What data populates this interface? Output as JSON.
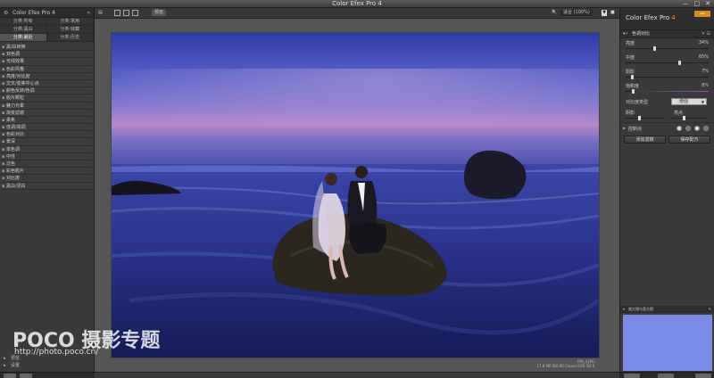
{
  "window": {
    "title": "Color Efex Pro 4",
    "buttons": [
      "—",
      "□",
      "✕"
    ]
  },
  "left_panel": {
    "brand": "Color Efex Pro 4",
    "categories": [
      "分类:所有",
      "分类:常用",
      "分类:黑白",
      "分类:收藏",
      "分类:最近",
      "分类:历史"
    ],
    "filters": [
      "黑/白转换",
      "双色调",
      "光线效果",
      "色彩风格",
      "亮度/对比度",
      "交叉/变焦中心点",
      "颜色反转/色调",
      "胶片颗粒",
      "魅力光晕",
      "渐变滤镜",
      "柔焦",
      "低调/高调",
      "色彩对比",
      "景深",
      "单色调",
      "中性",
      "泛色",
      "彩色胶片",
      "对比度",
      "黑白/漂白"
    ],
    "bottom_items": [
      "预览",
      "设置"
    ]
  },
  "toolbar": {
    "mode_label": "预览",
    "zoom_label": "适合 (100%)"
  },
  "image_info": {
    "filename": "RM_4.JPG",
    "details": "17.8 MP  ISO 80  Canon EOS 5D II"
  },
  "right_panel": {
    "app_name": "Color Efex Pro",
    "app_version": "4",
    "logo_text": "NIK",
    "filter_header": "色调对比",
    "sliders": [
      {
        "label": "亮度",
        "value": "34%",
        "fraction": 0.34
      },
      {
        "label": "中度",
        "value": "65%",
        "fraction": 0.65
      },
      {
        "label": "阴影",
        "value": "7%",
        "fraction": 0.07
      },
      {
        "label": "饱和度",
        "value": "8%",
        "fraction": 0.08
      }
    ],
    "select_label": "对比度类型",
    "select_value": "增强",
    "dual_sliders": {
      "left_label": "阴影",
      "right_label": "亮点",
      "left_fraction": 0.35,
      "right_fraction": 0.35
    },
    "control_points_label": "控制点",
    "buttons": [
      "添加滤镜",
      "保存配方"
    ],
    "loupe_label": "放大镜与直方图"
  },
  "watermark": {
    "brand": "POCO 摄影专题",
    "url": "http://photo.poco.cn/"
  }
}
